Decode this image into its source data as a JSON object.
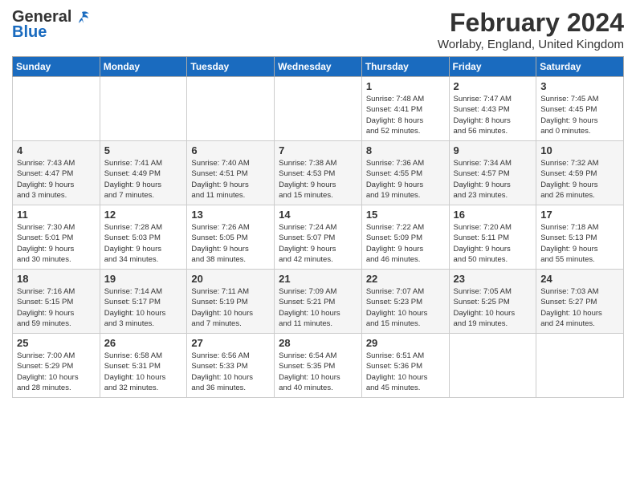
{
  "header": {
    "logo_general": "General",
    "logo_blue": "Blue",
    "month_title": "February 2024",
    "location": "Worlaby, England, United Kingdom"
  },
  "weekdays": [
    "Sunday",
    "Monday",
    "Tuesday",
    "Wednesday",
    "Thursday",
    "Friday",
    "Saturday"
  ],
  "weeks": [
    [
      {
        "day": "",
        "detail": ""
      },
      {
        "day": "",
        "detail": ""
      },
      {
        "day": "",
        "detail": ""
      },
      {
        "day": "",
        "detail": ""
      },
      {
        "day": "1",
        "detail": "Sunrise: 7:48 AM\nSunset: 4:41 PM\nDaylight: 8 hours\nand 52 minutes."
      },
      {
        "day": "2",
        "detail": "Sunrise: 7:47 AM\nSunset: 4:43 PM\nDaylight: 8 hours\nand 56 minutes."
      },
      {
        "day": "3",
        "detail": "Sunrise: 7:45 AM\nSunset: 4:45 PM\nDaylight: 9 hours\nand 0 minutes."
      }
    ],
    [
      {
        "day": "4",
        "detail": "Sunrise: 7:43 AM\nSunset: 4:47 PM\nDaylight: 9 hours\nand 3 minutes."
      },
      {
        "day": "5",
        "detail": "Sunrise: 7:41 AM\nSunset: 4:49 PM\nDaylight: 9 hours\nand 7 minutes."
      },
      {
        "day": "6",
        "detail": "Sunrise: 7:40 AM\nSunset: 4:51 PM\nDaylight: 9 hours\nand 11 minutes."
      },
      {
        "day": "7",
        "detail": "Sunrise: 7:38 AM\nSunset: 4:53 PM\nDaylight: 9 hours\nand 15 minutes."
      },
      {
        "day": "8",
        "detail": "Sunrise: 7:36 AM\nSunset: 4:55 PM\nDaylight: 9 hours\nand 19 minutes."
      },
      {
        "day": "9",
        "detail": "Sunrise: 7:34 AM\nSunset: 4:57 PM\nDaylight: 9 hours\nand 23 minutes."
      },
      {
        "day": "10",
        "detail": "Sunrise: 7:32 AM\nSunset: 4:59 PM\nDaylight: 9 hours\nand 26 minutes."
      }
    ],
    [
      {
        "day": "11",
        "detail": "Sunrise: 7:30 AM\nSunset: 5:01 PM\nDaylight: 9 hours\nand 30 minutes."
      },
      {
        "day": "12",
        "detail": "Sunrise: 7:28 AM\nSunset: 5:03 PM\nDaylight: 9 hours\nand 34 minutes."
      },
      {
        "day": "13",
        "detail": "Sunrise: 7:26 AM\nSunset: 5:05 PM\nDaylight: 9 hours\nand 38 minutes."
      },
      {
        "day": "14",
        "detail": "Sunrise: 7:24 AM\nSunset: 5:07 PM\nDaylight: 9 hours\nand 42 minutes."
      },
      {
        "day": "15",
        "detail": "Sunrise: 7:22 AM\nSunset: 5:09 PM\nDaylight: 9 hours\nand 46 minutes."
      },
      {
        "day": "16",
        "detail": "Sunrise: 7:20 AM\nSunset: 5:11 PM\nDaylight: 9 hours\nand 50 minutes."
      },
      {
        "day": "17",
        "detail": "Sunrise: 7:18 AM\nSunset: 5:13 PM\nDaylight: 9 hours\nand 55 minutes."
      }
    ],
    [
      {
        "day": "18",
        "detail": "Sunrise: 7:16 AM\nSunset: 5:15 PM\nDaylight: 9 hours\nand 59 minutes."
      },
      {
        "day": "19",
        "detail": "Sunrise: 7:14 AM\nSunset: 5:17 PM\nDaylight: 10 hours\nand 3 minutes."
      },
      {
        "day": "20",
        "detail": "Sunrise: 7:11 AM\nSunset: 5:19 PM\nDaylight: 10 hours\nand 7 minutes."
      },
      {
        "day": "21",
        "detail": "Sunrise: 7:09 AM\nSunset: 5:21 PM\nDaylight: 10 hours\nand 11 minutes."
      },
      {
        "day": "22",
        "detail": "Sunrise: 7:07 AM\nSunset: 5:23 PM\nDaylight: 10 hours\nand 15 minutes."
      },
      {
        "day": "23",
        "detail": "Sunrise: 7:05 AM\nSunset: 5:25 PM\nDaylight: 10 hours\nand 19 minutes."
      },
      {
        "day": "24",
        "detail": "Sunrise: 7:03 AM\nSunset: 5:27 PM\nDaylight: 10 hours\nand 24 minutes."
      }
    ],
    [
      {
        "day": "25",
        "detail": "Sunrise: 7:00 AM\nSunset: 5:29 PM\nDaylight: 10 hours\nand 28 minutes."
      },
      {
        "day": "26",
        "detail": "Sunrise: 6:58 AM\nSunset: 5:31 PM\nDaylight: 10 hours\nand 32 minutes."
      },
      {
        "day": "27",
        "detail": "Sunrise: 6:56 AM\nSunset: 5:33 PM\nDaylight: 10 hours\nand 36 minutes."
      },
      {
        "day": "28",
        "detail": "Sunrise: 6:54 AM\nSunset: 5:35 PM\nDaylight: 10 hours\nand 40 minutes."
      },
      {
        "day": "29",
        "detail": "Sunrise: 6:51 AM\nSunset: 5:36 PM\nDaylight: 10 hours\nand 45 minutes."
      },
      {
        "day": "",
        "detail": ""
      },
      {
        "day": "",
        "detail": ""
      }
    ]
  ]
}
